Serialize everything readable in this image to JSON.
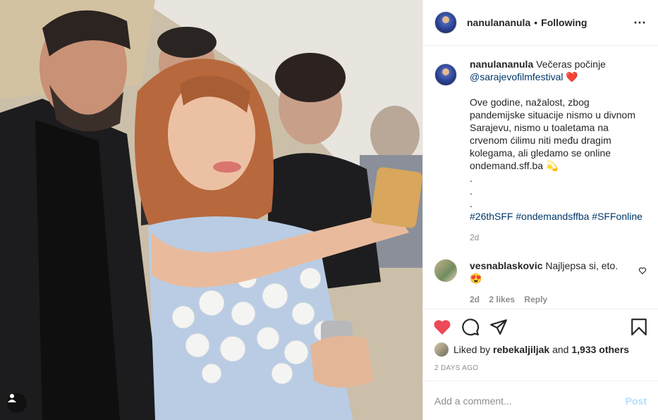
{
  "post": {
    "username": "nanulananula",
    "dot": "•",
    "follow_status": "Following",
    "more_icon": "⋯",
    "colors": {
      "like_red": "#ed4956",
      "link_blue": "#00376b",
      "post_disabled": "#b2dffc"
    }
  },
  "caption": {
    "username": "nanulananula",
    "line1": "Večeras počinje",
    "mention": "@sarajevofilmfestival",
    "heart_emoji": "❤️",
    "body": "Ove godine, nažalost, zbog pandemijske situacije nismo u divnom Sarajevu, nismo u toaletama na crvenom ćilimu niti među dragim kolegama, ali gledamo se online",
    "link": "ondemand.sff.ba",
    "sparkle_emoji": "💫",
    "dots": ".",
    "hashtags": "#26thSFF #ondemandsffba #SFFonline",
    "time": "2d"
  },
  "comment": {
    "username": "vesnablaskovic",
    "text": "Najljepsa si, eto.",
    "emoji": "😍",
    "time": "2d",
    "likes": "2 likes",
    "reply": "Reply"
  },
  "likes": {
    "prefix": "Liked by",
    "user": "rebekaljiljak",
    "and": "and",
    "count": "1,933 others"
  },
  "date": "2 DAYS AGO",
  "add_comment": {
    "placeholder": "Add a comment...",
    "post_label": "Post"
  },
  "icons": {
    "like": "heart-icon",
    "comment": "comment-icon",
    "share": "share-icon",
    "save": "bookmark-icon",
    "tags": "user-tag-icon"
  }
}
